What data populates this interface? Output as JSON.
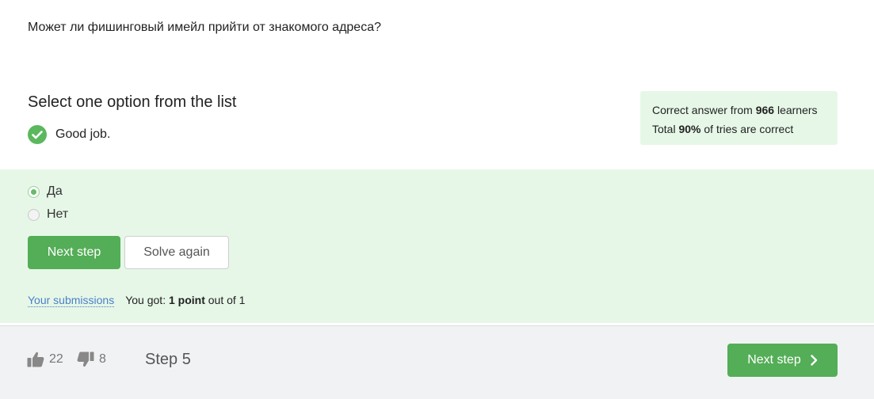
{
  "question": {
    "text": "Может ли фишинговый имейл прийти от знакомого адреса?"
  },
  "quiz": {
    "instruction": "Select one option from the list",
    "feedback": "Good job."
  },
  "stats": {
    "line1_prefix": "Correct answer from ",
    "line1_count": "966",
    "line1_suffix": " learners",
    "line2_prefix": "Total ",
    "line2_percent": "90%",
    "line2_suffix": " of tries are correct"
  },
  "options": [
    {
      "label": "Да",
      "selected": true
    },
    {
      "label": "Нет",
      "selected": false
    }
  ],
  "buttons": {
    "next_step": "Next step",
    "solve_again": "Solve again"
  },
  "result": {
    "submissions_link": "Your submissions",
    "got_prefix": "You got: ",
    "got_points": "1 point",
    "got_suffix": " out of 1"
  },
  "footer": {
    "likes": "22",
    "dislikes": "8",
    "step": "Step 5",
    "next_label": "Next step"
  },
  "colors": {
    "accent_green": "#54ad57",
    "success_bg": "#e6f7e7",
    "link_blue": "#4a7fc9"
  },
  "icons": {
    "feedback": "check-circle-icon",
    "like": "thumbs-up-icon",
    "dislike": "thumbs-down-icon",
    "next": "chevron-right-icon"
  }
}
